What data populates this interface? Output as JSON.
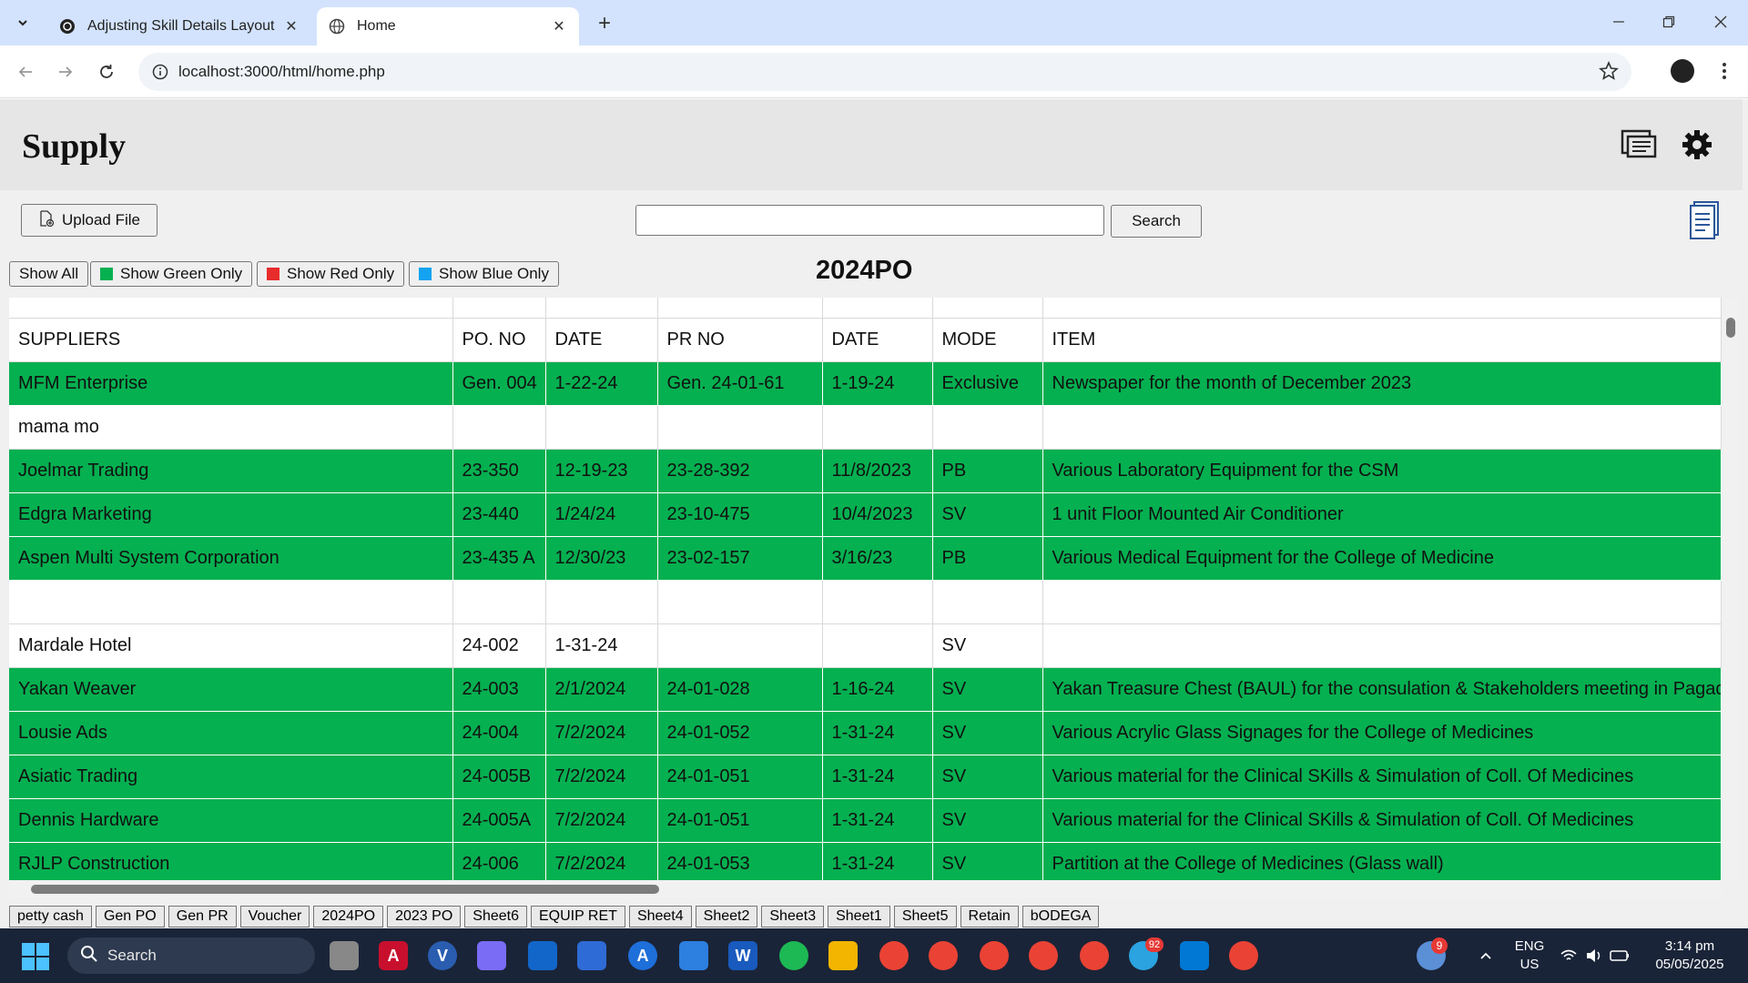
{
  "browser": {
    "tabs": [
      {
        "title": "Adjusting Skill Details Layout",
        "active": false
      },
      {
        "title": "Home",
        "active": true
      }
    ],
    "url": "localhost:3000/html/home.php"
  },
  "app": {
    "title": "Supply",
    "upload_label": "Upload File",
    "search_placeholder": "",
    "search_label": "Search",
    "sheet_title": "2024PO",
    "filters": [
      {
        "label": "Show All",
        "color": ""
      },
      {
        "label": "Show Green Only",
        "color": "#05b050"
      },
      {
        "label": "Show Red Only",
        "color": "#e82c2c"
      },
      {
        "label": "Show Blue Only",
        "color": "#13a3f0"
      }
    ]
  },
  "table": {
    "headers": [
      "SUPPLIERS",
      "PO. NO",
      "DATE",
      "PR NO",
      "DATE",
      "MODE",
      "ITEM"
    ],
    "rows": [
      {
        "status": "green",
        "cells": [
          "MFM Enterprise",
          "Gen. 004",
          "1-22-24",
          "Gen. 24-01-61",
          "1-19-24",
          "Exclusive",
          "Newspaper for the month of December 2023"
        ]
      },
      {
        "status": "none",
        "cells": [
          "mama mo",
          "",
          "",
          "",
          "",
          "",
          ""
        ]
      },
      {
        "status": "green",
        "cells": [
          "Joelmar Trading",
          "23-350",
          "12-19-23",
          "23-28-392",
          "11/8/2023",
          "PB",
          "Various Laboratory Equipment for the CSM"
        ]
      },
      {
        "status": "green",
        "cells": [
          "Edgra Marketing",
          "23-440",
          "1/24/24",
          "23-10-475",
          "10/4/2023",
          "SV",
          "1 unit Floor Mounted Air Conditioner"
        ]
      },
      {
        "status": "green",
        "cells": [
          "Aspen Multi System Corporation",
          "23-435 A",
          "12/30/23",
          "23-02-157",
          "3/16/23",
          "PB",
          "Various Medical Equipment for the College of Medicine"
        ]
      },
      {
        "status": "none",
        "cells": [
          "",
          "",
          "",
          "",
          "",
          "",
          ""
        ]
      },
      {
        "status": "none",
        "cells": [
          "Mardale Hotel",
          "24-002",
          "1-31-24",
          "",
          "",
          "SV",
          ""
        ]
      },
      {
        "status": "green",
        "cells": [
          "Yakan Weaver",
          "24-003",
          "2/1/2024",
          "24-01-028",
          "1-16-24",
          "SV",
          "Yakan Treasure Chest (BAUL) for the consulation & Stakeholders meeting in Pagadian"
        ]
      },
      {
        "status": "green",
        "cells": [
          "Lousie Ads",
          "24-004",
          "7/2/2024",
          "24-01-052",
          "1-31-24",
          "SV",
          "Various Acrylic Glass Signages for the College of Medicines"
        ]
      },
      {
        "status": "green",
        "cells": [
          "Asiatic Trading",
          "24-005B",
          "7/2/2024",
          "24-01-051",
          "1-31-24",
          "SV",
          "Various material for the Clinical SKills & Simulation of Coll. Of Medicines"
        ]
      },
      {
        "status": "green",
        "cells": [
          "Dennis Hardware",
          "24-005A",
          "7/2/2024",
          "24-01-051",
          "1-31-24",
          "SV",
          "Various material for the Clinical SKills & Simulation of Coll. Of Medicines"
        ]
      },
      {
        "status": "green",
        "cells": [
          "RJLP Construction",
          "24-006",
          "7/2/2024",
          "24-01-053",
          "1-31-24",
          "SV",
          "Partition at the College of Medicines (Glass wall)"
        ]
      }
    ]
  },
  "sheet_tabs": [
    "petty cash",
    "Gen PO",
    "Gen PR",
    "Voucher",
    "2024PO",
    "2023 PO",
    "Sheet6",
    "EQUIP RET",
    "Sheet4",
    "Sheet2",
    "Sheet3",
    "Sheet1",
    "Sheet5",
    "Retain",
    "bODEGA"
  ],
  "taskbar": {
    "search_label": "Search",
    "weather_badge": "9",
    "telegram_badge": "92",
    "lang_line1": "ENG",
    "lang_line2": "US",
    "time": "3:14 pm",
    "date": "05/05/2025"
  },
  "colors": {
    "green_row": "#05b050",
    "accent": "#1a73e8"
  }
}
